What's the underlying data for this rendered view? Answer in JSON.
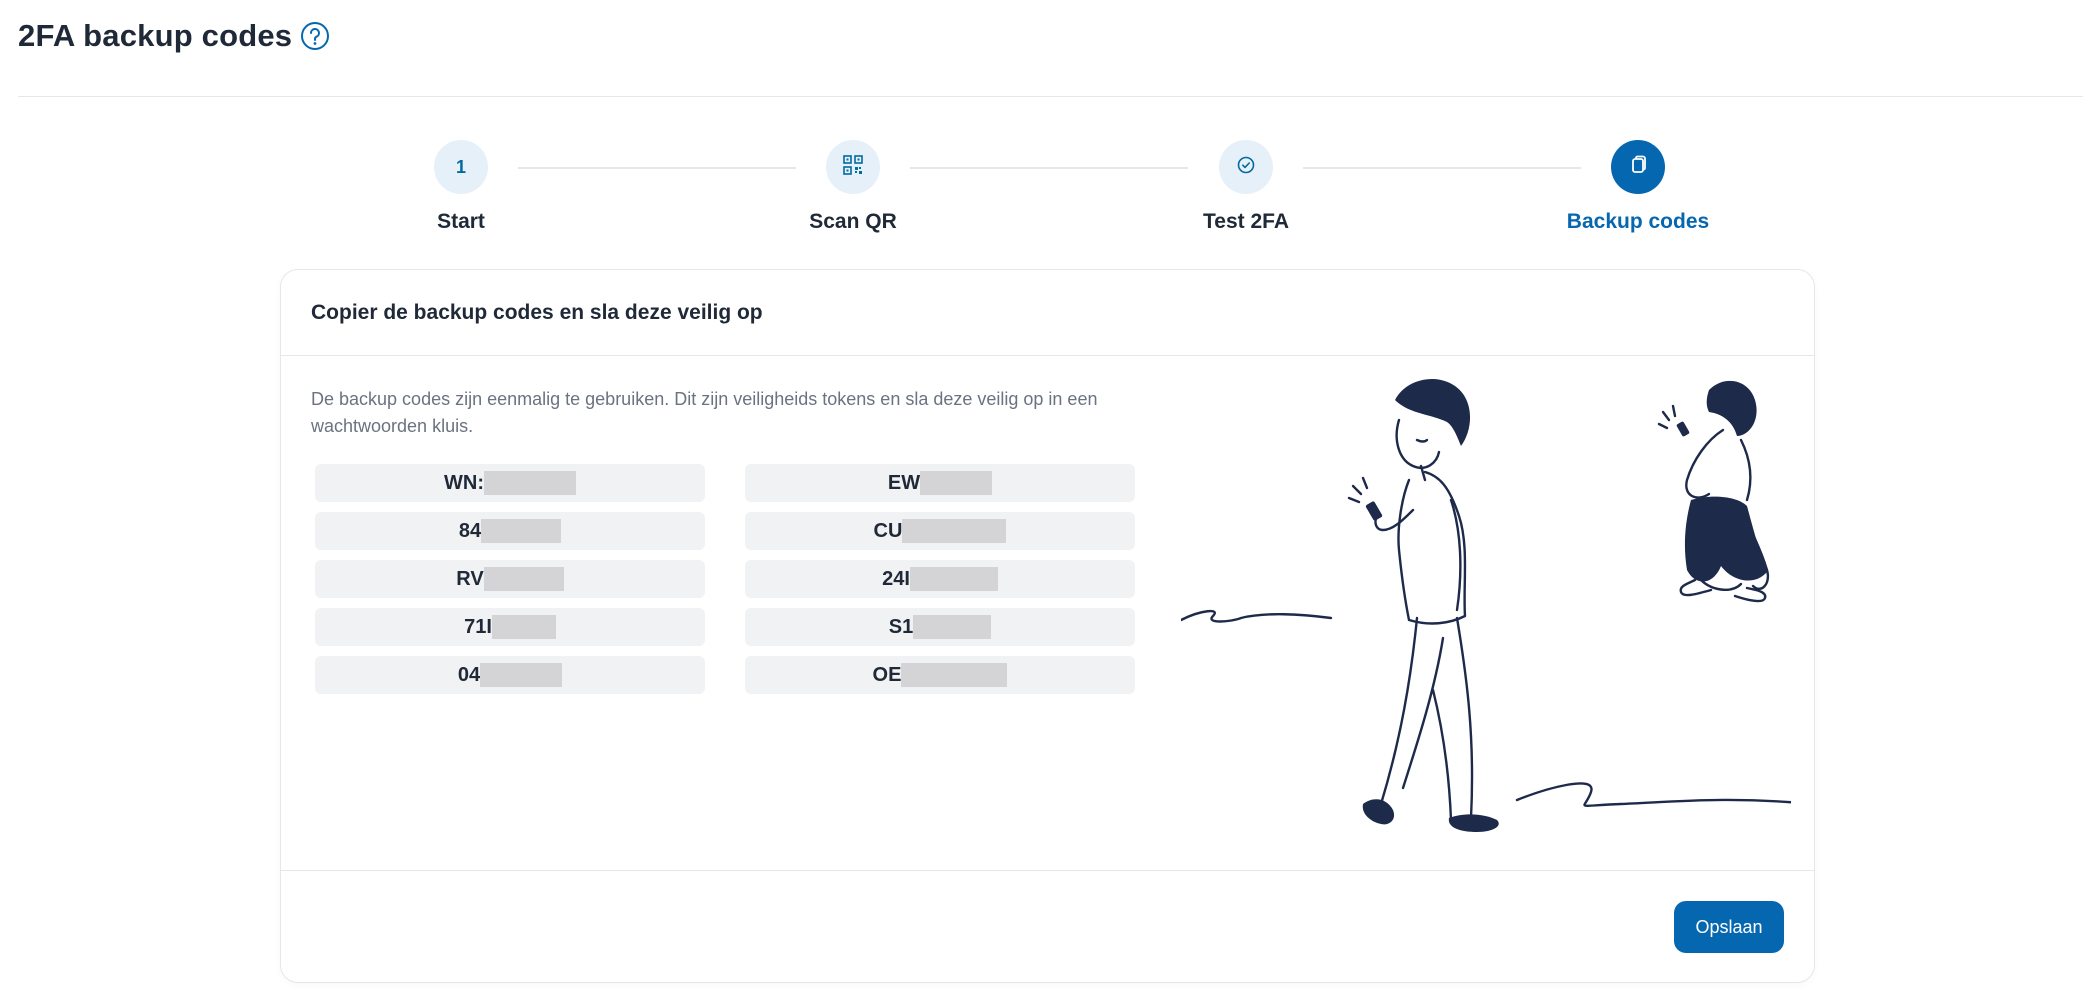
{
  "page": {
    "title": "2FA backup codes",
    "help_icon": "question-circle-icon"
  },
  "stepper": {
    "steps": [
      {
        "label": "Start",
        "marker": "1",
        "icon": "number",
        "active": false
      },
      {
        "label": "Scan QR",
        "marker": "",
        "icon": "qr-code-icon",
        "active": false
      },
      {
        "label": "Test 2FA",
        "marker": "",
        "icon": "check-circle-icon",
        "active": false
      },
      {
        "label": "Backup codes",
        "marker": "",
        "icon": "copy-icon",
        "active": true
      }
    ]
  },
  "card": {
    "title": "Copier de backup codes en sla deze veilig op",
    "description": "De backup codes zijn eenmalig te gebruiken. Dit zijn veiligheids tokens en sla deze veilig op in een wachtwoorden kluis.",
    "codes_left": [
      {
        "prefix": "WN:"
      },
      {
        "prefix": "84"
      },
      {
        "prefix": "RV"
      },
      {
        "prefix": "71I"
      },
      {
        "prefix": "04"
      }
    ],
    "codes_right": [
      {
        "prefix": "EW"
      },
      {
        "prefix": "CU"
      },
      {
        "prefix": "24I"
      },
      {
        "prefix": "S1"
      },
      {
        "prefix": "OE"
      }
    ],
    "save_label": "Opslaan"
  },
  "colors": {
    "accent": "#0667b1",
    "step_bg": "#e6f0f8",
    "code_bg": "#f1f2f3",
    "redaction": "#d4d4d6",
    "illustration_ink": "#1e2a4a"
  }
}
